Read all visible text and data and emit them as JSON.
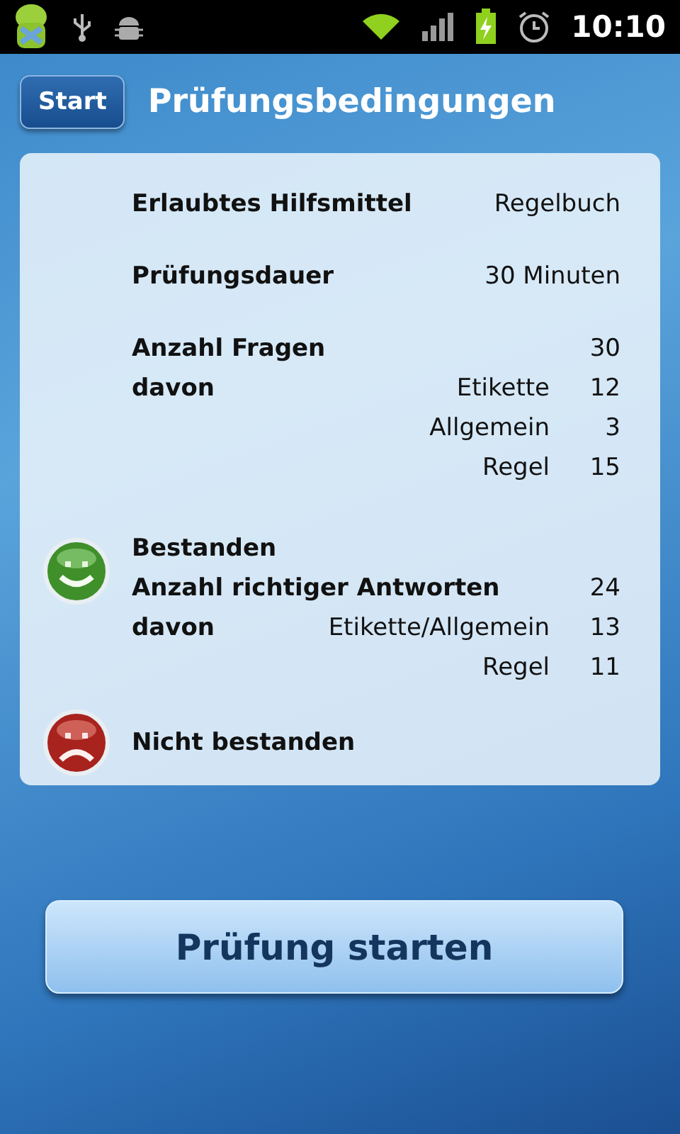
{
  "status_bar": {
    "time": "10:10"
  },
  "header": {
    "back_button": "Start",
    "title": "Prüfungsbedingungen"
  },
  "sections": [
    {
      "kind": "plain",
      "rows": [
        {
          "label": "Erlaubtes Hilfsmittel",
          "value": "Regelbuch"
        }
      ]
    },
    {
      "kind": "plain",
      "rows": [
        {
          "label": "Prüfungsdauer",
          "value": "30 Minuten"
        }
      ]
    },
    {
      "kind": "plain",
      "rows": [
        {
          "label": "Anzahl Fragen",
          "value": "30"
        },
        {
          "label": "davon",
          "sublabel": "Etikette",
          "value": "12"
        },
        {
          "sublabel": "Allgemein",
          "value": "3"
        },
        {
          "sublabel": "Regel",
          "value": "15"
        }
      ]
    },
    {
      "kind": "passed",
      "rows": [
        {
          "label": "Bestanden"
        },
        {
          "label": "Anzahl richtiger Antworten",
          "value": "24"
        },
        {
          "label": "davon",
          "sublabel": "Etikette/Allgemein",
          "value": "13"
        },
        {
          "sublabel": "Regel",
          "value": "11"
        }
      ]
    },
    {
      "kind": "failed",
      "rows": [
        {
          "label": "Nicht bestanden"
        }
      ]
    }
  ],
  "start_button": "Prüfung starten"
}
